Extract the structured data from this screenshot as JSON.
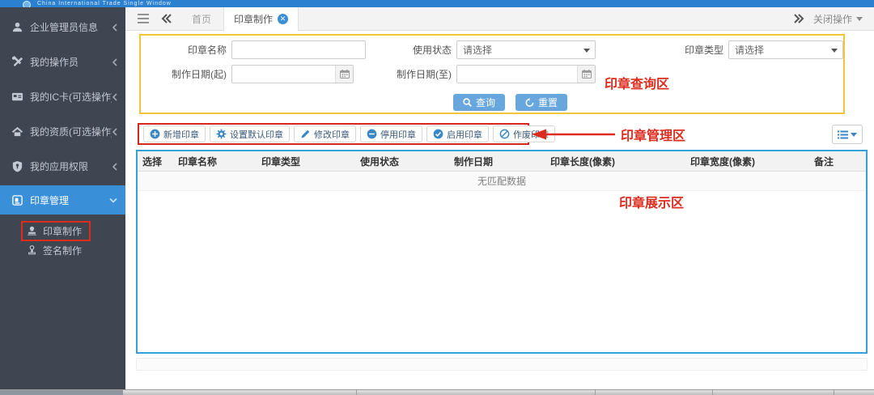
{
  "top_bar": {
    "brand": "China International Trade Single Window"
  },
  "sidebar": {
    "items": [
      {
        "label": "企业管理员信息"
      },
      {
        "label": "我的操作员"
      },
      {
        "label": "我的IC卡(可选操作)"
      },
      {
        "label": "我的资质(可选操作)"
      },
      {
        "label": "我的应用权限"
      },
      {
        "label": "印章管理"
      }
    ],
    "sub_items": [
      {
        "label": "印章制作"
      },
      {
        "label": "签名制作"
      }
    ]
  },
  "tab_bar": {
    "tabs": [
      {
        "label": "首页"
      },
      {
        "label": "印章制作"
      }
    ],
    "close_ops_label": "关闭操作"
  },
  "query_panel": {
    "seal_name_label": "印章名称",
    "use_status_label": "使用状态",
    "seal_type_label": "印章类型",
    "date_from_label": "制作日期(起)",
    "date_to_label": "制作日期(至)",
    "select_placeholder": "请选择",
    "search_label": "查询",
    "reset_label": "重置"
  },
  "toolbar": {
    "buttons": [
      {
        "label": "新增印章"
      },
      {
        "label": "设置默认印章"
      },
      {
        "label": "修改印章"
      },
      {
        "label": "停用印章"
      },
      {
        "label": "启用印章"
      },
      {
        "label": "作废印章"
      }
    ]
  },
  "table": {
    "headers": [
      "选择",
      "印章名称",
      "印章类型",
      "使用状态",
      "制作日期",
      "印章长度(像素)",
      "印章宽度(像素)",
      "备注"
    ],
    "empty_text": "无匹配数据"
  },
  "annotations": {
    "query_area": "印章查询区",
    "manage_area": "印章管理区",
    "display_area": "印章展示区"
  },
  "colors": {
    "accent_blue": "#3a8fd9",
    "annotation_red": "#dd2c1e",
    "panel_yellow_border": "#f2c53d",
    "table_blue_border": "#35a0d9",
    "sidebar_bg": "#3f4551",
    "topbar_blue": "#2b80d0"
  }
}
